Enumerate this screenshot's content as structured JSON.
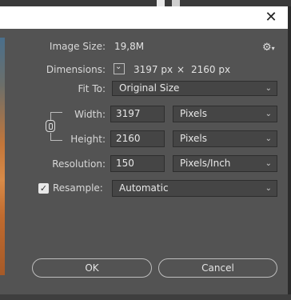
{
  "dialog": {
    "close_glyph": "✕"
  },
  "fields": {
    "image_size_label": "Image Size:",
    "image_size_value": "19,8M",
    "dimensions_label": "Dimensions:",
    "dim_width": "3197 px",
    "dim_times": "×",
    "dim_height": "2160 px",
    "fit_to_label": "Fit To:",
    "fit_to_value": "Original Size",
    "width_label": "Width:",
    "width_value": "3197",
    "width_unit": "Pixels",
    "height_label": "Height:",
    "height_value": "2160",
    "height_unit": "Pixels",
    "resolution_label": "Resolution:",
    "resolution_value": "150",
    "resolution_unit": "Pixels/Inch",
    "resample_label": "Resample:",
    "resample_value": "Automatic",
    "resample_checked": true
  },
  "buttons": {
    "ok": "OK",
    "cancel": "Cancel"
  },
  "icons": {
    "gear": "⚙",
    "chevron": "⌄",
    "check": "✓"
  }
}
